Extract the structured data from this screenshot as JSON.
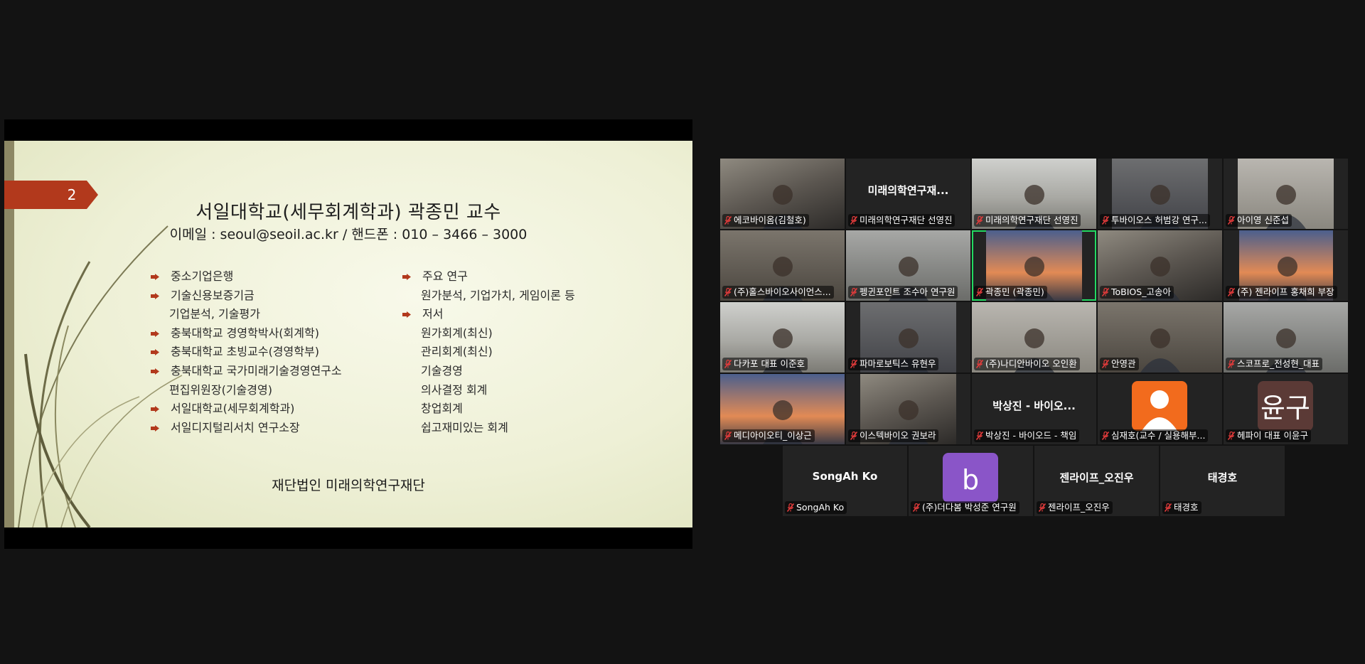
{
  "slide": {
    "page_number": "2",
    "title": "서일대학교(세무회계학과) 곽종민 교수",
    "contact": "이메일 : seoul@seoil.ac.kr / 핸드폰 : 010 – 3466 – 3000",
    "left_items": [
      {
        "text": "중소기업은행",
        "bullet": true
      },
      {
        "text": "기술신용보증기금",
        "bullet": true
      },
      {
        "text": "기업분석, 기술평가",
        "bullet": false
      },
      {
        "text": "충북대학교 경영학박사(회계학)",
        "bullet": true
      },
      {
        "text": "충북대학교 초빙교수(경영학부)",
        "bullet": true
      },
      {
        "text": "충북대학교 국가미래기술경영연구소",
        "bullet": true
      },
      {
        "text": "편집위원장(기술경영)",
        "bullet": false
      },
      {
        "text": "서일대학교(세무회계학과)",
        "bullet": true
      },
      {
        "text": "서일디지털리서치 연구소장",
        "bullet": true
      }
    ],
    "right_items": [
      {
        "text": "주요 연구",
        "bullet": true
      },
      {
        "text": "원가분석, 기업가치, 게임이론 등",
        "bullet": false
      },
      {
        "text": "저서",
        "bullet": true
      },
      {
        "text": "원가회계(최신)",
        "bullet": false
      },
      {
        "text": "관리회계(최신)",
        "bullet": false
      },
      {
        "text": "기술경영",
        "bullet": false
      },
      {
        "text": "의사결정 회계",
        "bullet": false
      },
      {
        "text": "창업회계",
        "bullet": false
      },
      {
        "text": "쉽고재미있는 회계",
        "bullet": false
      }
    ],
    "footer": "재단법인 미래의학연구재단"
  },
  "participants": [
    {
      "name": "에코바이옴(김철호)",
      "kind": "video"
    },
    {
      "name": "미래의학연구재단 선영진",
      "kind": "text",
      "big": "미래의학연구재..."
    },
    {
      "name": "미래의학연구재단 선영진",
      "kind": "video"
    },
    {
      "name": "투바이오스 허범강 연구...",
      "kind": "video"
    },
    {
      "name": "아이영 신준섭",
      "kind": "video"
    },
    {
      "name": "(주)홀스바이오사이언스...",
      "kind": "video"
    },
    {
      "name": "펭귄포인트 조수아 연구원",
      "kind": "video"
    },
    {
      "name": "곽종민 (곽종민)",
      "kind": "video",
      "active": true
    },
    {
      "name": "ToBIOS_고송아",
      "kind": "video"
    },
    {
      "name": "(주) 젠라이프 홍채희 부장",
      "kind": "video"
    },
    {
      "name": "다카포 대표 이준호",
      "kind": "video"
    },
    {
      "name": "파마로보틱스 유현우",
      "kind": "video"
    },
    {
      "name": "(주)나디안바이오 오인환",
      "kind": "video"
    },
    {
      "name": "안영관",
      "kind": "video"
    },
    {
      "name": "스코프로_전성현_대표",
      "kind": "video"
    },
    {
      "name": "메디아이오티_이상근",
      "kind": "video"
    },
    {
      "name": "이스텍바이오 권보라",
      "kind": "video"
    },
    {
      "name": "박상진 - 바이오드 - 책임",
      "kind": "text",
      "big": "박상진 - 바이오..."
    },
    {
      "name": "심재호(교수 / 실용해부...",
      "kind": "avatar-person",
      "avatar_color": "#f26b1d"
    },
    {
      "name": "헤파이 대표 이윤구",
      "kind": "avatar-letter",
      "avatar_color": "#5b3a36",
      "avatar_text": "윤구"
    },
    {
      "name": "SongAh Ko",
      "kind": "text",
      "big": "SongAh Ko"
    },
    {
      "name": "(주)더다봄 박성준 연구원",
      "kind": "avatar-letter",
      "avatar_color": "#8a55c8",
      "avatar_text": "b"
    },
    {
      "name": "젠라이프_오진우",
      "kind": "text",
      "big": "젠라이프_오진우"
    },
    {
      "name": "태경호",
      "kind": "text",
      "big": "태경호"
    }
  ]
}
